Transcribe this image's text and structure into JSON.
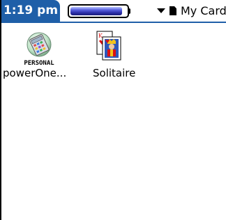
{
  "statusbar": {
    "time": "1:19 pm",
    "battery_level": 0.92,
    "category": "My Card"
  },
  "apps": [
    {
      "name": "powerOne...",
      "icon": "calculator-icon",
      "icon_caption": "PERSONAL"
    },
    {
      "name": "Solitaire",
      "icon": "playing-card-icon"
    }
  ],
  "colors": {
    "accent": "#1f5fa8",
    "background": "#ffffff"
  }
}
